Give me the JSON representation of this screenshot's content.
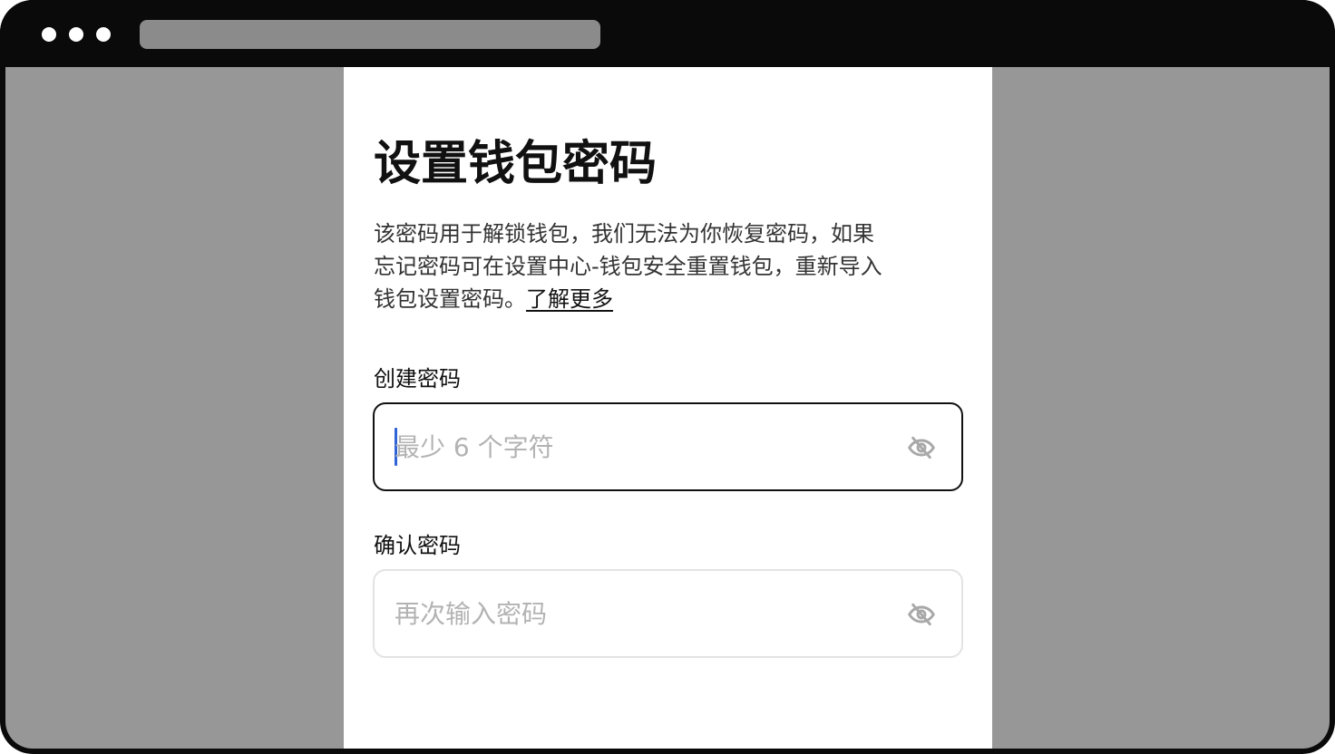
{
  "page": {
    "title": "设置钱包密码",
    "description_lines": [
      "该密码用于解锁钱包，我们无法为你恢复密码，如果",
      "忘记密码可在设置中心-钱包安全重置钱包，重新导入",
      "钱包设置密码。"
    ],
    "learn_more": "了解更多"
  },
  "form": {
    "create": {
      "label": "创建密码",
      "placeholder": "最少 6 个字符",
      "value": "",
      "visibility_icon": "eye-off-icon"
    },
    "confirm": {
      "label": "确认密码",
      "placeholder": "再次输入密码",
      "value": "",
      "visibility_icon": "eye-off-icon"
    }
  },
  "colors": {
    "caret": "#2f63d8",
    "placeholder": "#b3b3b3",
    "active_border": "#111111",
    "idle_border": "#e3e3e3",
    "backdrop": "#979797"
  }
}
